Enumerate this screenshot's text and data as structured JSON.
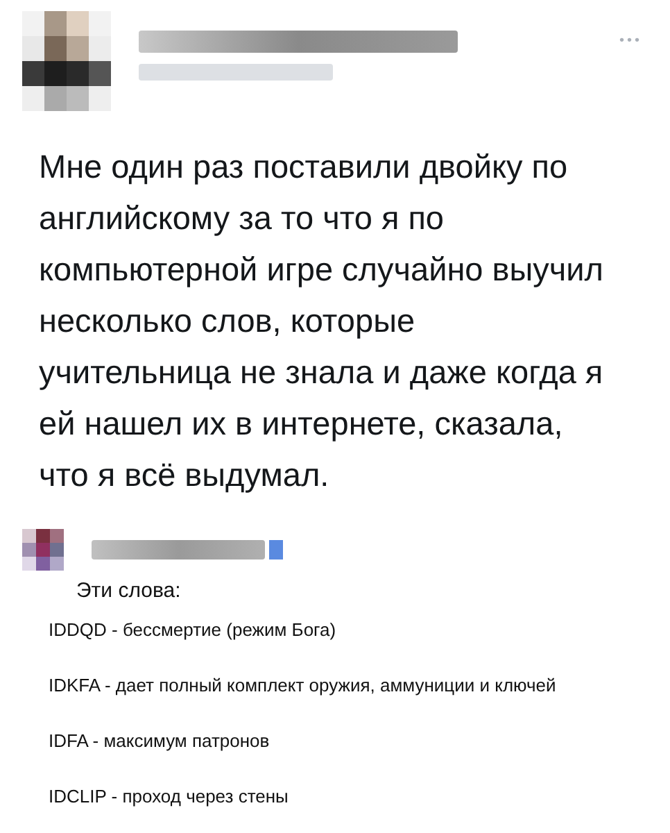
{
  "tweet": {
    "more_icon": "•••",
    "text": "Мне один раз поставили двойку по английскому за то что я по компьютерной игре случайно выучил несколько слов, которые учительница не знала и даже когда я ей нашел их в интернете, сказала, что я всё выдумал."
  },
  "reply": {
    "intro": "Эти слова:",
    "lines": [
      "IDDQD - бессмертие (режим Бога)",
      "IDKFA - дает полный комплект оружия, аммуниции и ключей",
      "IDFA - максимум патронов",
      "IDCLIP - проход через стены"
    ]
  }
}
